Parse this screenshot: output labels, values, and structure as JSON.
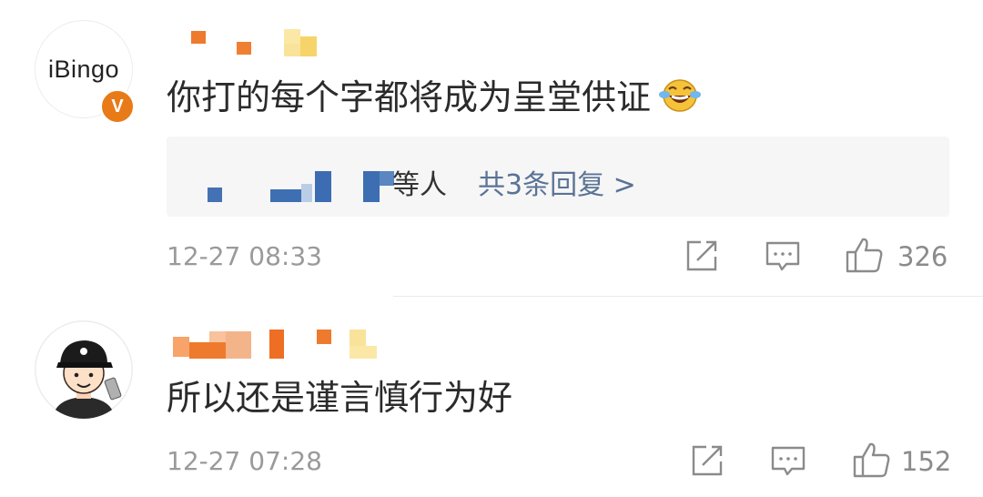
{
  "comments": [
    {
      "avatar_text": "iBingo",
      "verified_badge": "V",
      "text": "你打的每个字都将成为呈堂供证",
      "emoji": "laughing-crying-emoji",
      "reply": {
        "suffix": "等人",
        "link": "共3条回复 >"
      },
      "time": "12-27 08:33",
      "likes": "326"
    },
    {
      "avatar_icon": "cartoon-boy-avatar",
      "text": "所以还是谨言慎行为好",
      "time": "12-27 07:28",
      "likes": "152"
    }
  ],
  "icons": {
    "share": "share-icon",
    "comment": "comment-icon",
    "like": "thumbs-up-icon"
  },
  "colors": {
    "link": "#5a7396",
    "meta": "#9a9a9a",
    "badge": "#e87a18",
    "mosaic_orange": "#ee7a2e",
    "mosaic_blue": "#3e6fb3"
  }
}
